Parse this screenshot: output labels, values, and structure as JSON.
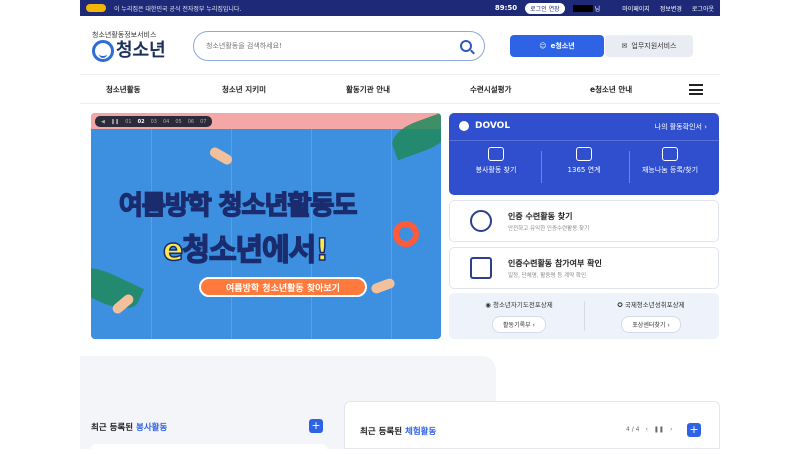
{
  "topbar": {
    "notice": "이 누리집은 대한민국 공식 전자정부 누리집입니다.",
    "timer": "89:50",
    "extend_label": "로그인 연장",
    "user_suffix": "님",
    "links": [
      "마이페이지",
      "정보변경",
      "로그아웃"
    ]
  },
  "header": {
    "logo_small": "청소년활동정보서비스",
    "logo_big": "청소년",
    "search_placeholder": "청소년활동을 검색하세요!",
    "service_e": "e청소년",
    "service_biz": "업무지원서비스"
  },
  "nav": {
    "items": [
      "청소년활동",
      "청소년 지키미",
      "활동기관 안내",
      "수련시설평가",
      "e청소년 안내"
    ]
  },
  "banner": {
    "pages": [
      "01",
      "02",
      "03",
      "04",
      "05",
      "06",
      "07"
    ],
    "active_page": "02",
    "title_line1": "여름방학 청소년활동도",
    "title_line2": "e청소년에서!",
    "cta": "여름방학 청소년활동 찾아보기"
  },
  "dovol": {
    "title": "DOVOL",
    "my_activity": "나의 활동확인서",
    "items": [
      {
        "label": "봉사활동 찾기",
        "icon": "volunteer-hand-icon"
      },
      {
        "label": "1365 연계",
        "icon": "network-icon"
      },
      {
        "label": "재능나눔 등록/찾기",
        "icon": "monitor-icon"
      }
    ]
  },
  "cards": [
    {
      "title": "인증 수련활동 찾기",
      "desc": "안전하고 유익한 인증수련활동 찾기",
      "icon": "search-globe-icon"
    },
    {
      "title": "인증수련활동 참가여부 확인",
      "desc": "일정, 단체명, 활동명 등 계약 확인",
      "icon": "checklist-icon"
    }
  ],
  "awards": [
    {
      "title": "청소년자기도전포상제",
      "button": "활동기록부",
      "icon": "medal-icon"
    },
    {
      "title": "국제청소년성취포상제",
      "button": "포상센터찾기",
      "icon": "award-badge-icon"
    }
  ],
  "sections": {
    "volunteer_prefix": "최근 등록된 ",
    "volunteer_hl": "봉사활동",
    "experience_prefix": "최근 등록된 ",
    "experience_hl": "체험활동",
    "pager": "4 / 4"
  },
  "colors": {
    "navy": "#1e2a78",
    "primary": "#2e63e6",
    "dovol": "#2f4fcf",
    "banner_bg": "#3d8fe0",
    "accent_orange": "#ff7a3c"
  }
}
